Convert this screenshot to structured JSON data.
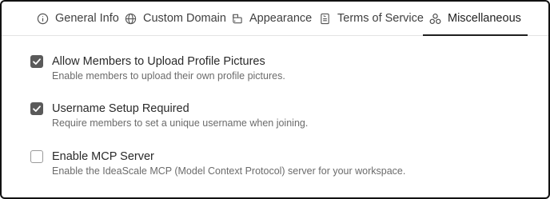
{
  "tabs": [
    {
      "label": "General Info",
      "icon": "info-circle-icon",
      "active": false
    },
    {
      "label": "Custom Domain",
      "icon": "globe-icon",
      "active": false
    },
    {
      "label": "Appearance",
      "icon": "palette-icon",
      "active": false
    },
    {
      "label": "Terms of Service",
      "icon": "document-icon",
      "active": false
    },
    {
      "label": "Miscellaneous",
      "icon": "shapes-icon",
      "active": true
    }
  ],
  "settings": [
    {
      "title": "Allow Members to Upload Profile Pictures",
      "description": "Enable members to upload their own profile pictures.",
      "checked": true
    },
    {
      "title": "Username Setup Required",
      "description": "Require members to set a unique username when joining.",
      "checked": true
    },
    {
      "title": "Enable MCP Server",
      "description": "Enable the IdeaScale MCP (Model Context Protocol) server for your workspace.",
      "checked": false
    }
  ],
  "colors": {
    "checkbox_checked": "#5a5a5a",
    "active_tab_underline": "#1f1f1f",
    "divider": "#e3e3e3"
  }
}
